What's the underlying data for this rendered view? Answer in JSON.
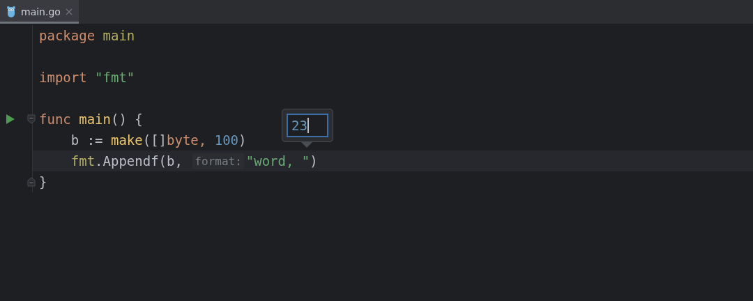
{
  "tabs": [
    {
      "label": "main.go",
      "selected": true
    }
  ],
  "lines": [
    {
      "kind": "code",
      "tokens": [
        {
          "kind": "keyword",
          "text": "package "
        },
        {
          "kind": "ident",
          "text": "main"
        }
      ]
    },
    {
      "kind": "blank"
    },
    {
      "kind": "code",
      "tokens": [
        {
          "kind": "keyword",
          "text": "import "
        },
        {
          "kind": "string",
          "text": "\"fmt\""
        }
      ]
    },
    {
      "kind": "blank"
    },
    {
      "kind": "code",
      "run": true,
      "fold_start": true,
      "tokens": [
        {
          "kind": "keyword",
          "text": "func "
        },
        {
          "kind": "decl",
          "text": "main"
        },
        {
          "kind": "plain",
          "text": "() {"
        }
      ]
    },
    {
      "kind": "code",
      "tokens": [
        {
          "kind": "plain",
          "text": "    b := "
        },
        {
          "kind": "decl",
          "text": "make"
        },
        {
          "kind": "plain",
          "text": "([]"
        },
        {
          "kind": "keyword",
          "text": "byte, "
        },
        {
          "kind": "number",
          "text": "100"
        },
        {
          "kind": "plain",
          "text": ")"
        }
      ]
    },
    {
      "kind": "code",
      "current": true,
      "tokens": [
        {
          "kind": "ident",
          "text": "    fmt"
        },
        {
          "kind": "plain",
          "text": ".Appendf(b, "
        },
        {
          "kind": "hint",
          "text": "format:"
        },
        {
          "kind": "string",
          "text": "\"word, \""
        },
        {
          "kind": "plain",
          "text": ")"
        }
      ]
    },
    {
      "kind": "code",
      "fold_end": true,
      "tokens": [
        {
          "kind": "plain",
          "text": "}"
        }
      ]
    }
  ],
  "popup": {
    "value": "23"
  }
}
